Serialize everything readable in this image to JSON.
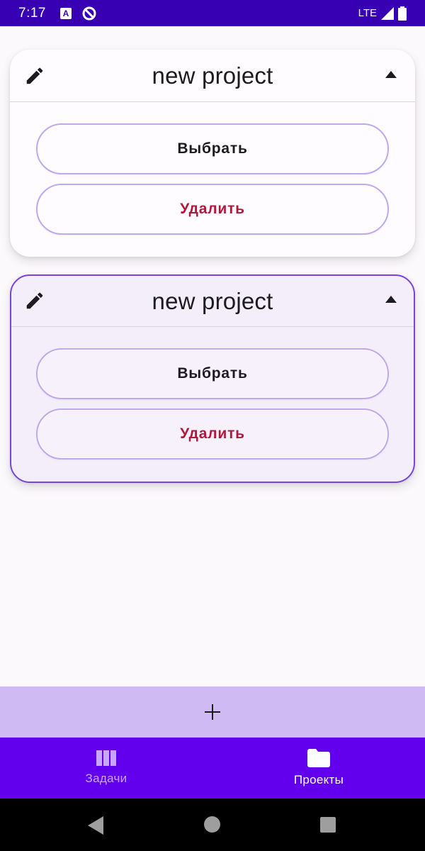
{
  "status_bar": {
    "time": "7:17",
    "network": "LTE"
  },
  "projects": [
    {
      "title": "new project",
      "select_label": "Выбрать",
      "delete_label": "Удалить"
    },
    {
      "title": "new project",
      "select_label": "Выбрать",
      "delete_label": "Удалить"
    }
  ],
  "bottom_nav": {
    "items": [
      {
        "label": "Задачи",
        "icon": "columns-icon"
      },
      {
        "label": "Проекты",
        "icon": "folder-icon"
      }
    ]
  },
  "colors": {
    "status_bar": "#3700b3",
    "nav_bar": "#6200ee",
    "add_bar": "#cfbaf3",
    "delete_text": "#b3173a",
    "selected_border": "#7a45d6"
  }
}
